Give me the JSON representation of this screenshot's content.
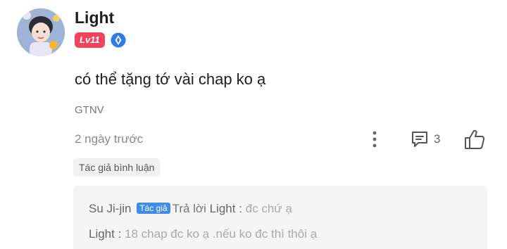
{
  "comment": {
    "username": "Light",
    "level_badge": "Lv11",
    "badge_icon": "blue-gem-icon",
    "text": "có thể tặng tớ vài chap ko ạ",
    "tag": "GTNV",
    "timestamp": "2 ngày trước",
    "reply_count": "3",
    "author_comment_label": "Tác giả bình luận"
  },
  "replies": [
    {
      "name": "Su Ji-jin",
      "badge": "Tác giả",
      "verb": "Trả lời",
      "target": "Light",
      "separator": " : ",
      "text": "đc chứ ạ"
    },
    {
      "name": "Light",
      "separator": " : ",
      "text": "18 chap đc ko ạ .nếu ko đc thì thôi ạ"
    }
  ],
  "colors": {
    "level_badge": "#f0445c",
    "author_tag": "#3e8de3",
    "reply_bg": "#f5f5f5"
  }
}
